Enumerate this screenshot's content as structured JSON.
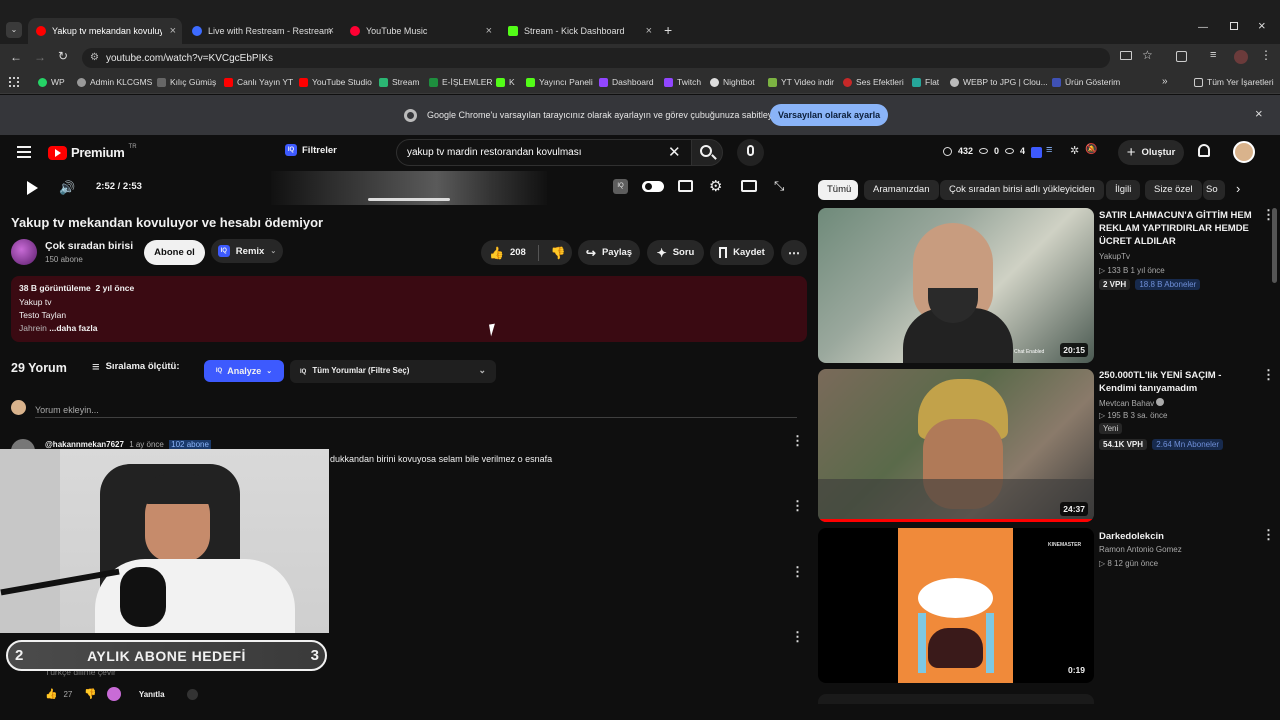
{
  "browser": {
    "tabs": [
      {
        "label": "Yakup tv mekandan kovuluyor ve"
      },
      {
        "label": "Live with Restream - Restream"
      },
      {
        "label": "YouTube Music"
      },
      {
        "label": "Stream - Kick Dashboard"
      }
    ],
    "url": "youtube.com/watch?v=KVCgcEbPIKs",
    "bookmarks": [
      "WP",
      "Admin KLCGMS",
      "Kılıç Gümüş",
      "Canlı Yayın YT",
      "YouTube Studio",
      "Stream",
      "E-İŞLEMLER",
      "K",
      "Yayıncı Paneli",
      "Dashboard",
      "Twitch",
      "Nightbot",
      "YT Video indir",
      "Ses Efektleri",
      "Flat",
      "WEBP to JPG | Clou...",
      "Ürün Gösterim"
    ],
    "all_bookmarks": "Tüm Yer İşaretleri",
    "infobar_text": "Google Chrome'u varsayılan tarayıcınız olarak ayarlayın ve görev çubuğunuza sabitleyin",
    "infobar_button": "Varsayılan olarak ayarla"
  },
  "yt": {
    "logo": "Premium",
    "logo_sup": "TR",
    "filters_label": "Filtreler",
    "search_value": "yakup tv mardin restorandan kovulması",
    "stats": {
      "a": "432",
      "b": "0",
      "c": "4"
    },
    "create_label": "Oluştur"
  },
  "player": {
    "time": "2:52 / 2:53"
  },
  "video": {
    "title": "Yakup tv mekandan kovuluyor ve hesabı ödemiyor",
    "channel": "Çok sıradan birisi",
    "subs": "150 abone",
    "subscribe": "Abone ol",
    "remix": "Remix",
    "likes": "208",
    "share": "Paylaş",
    "ask": "Soru",
    "save": "Kaydet",
    "desc_meta": "38 B görüntüleme  2 yıl önce",
    "desc_lines": [
      "Yakup tv",
      "Testo Taylan",
      "Jahrein"
    ],
    "desc_more": "...daha fazla"
  },
  "comments": {
    "count": "29 Yorum",
    "sort": "Sıralama ölçütü:",
    "analyze": "Analyze",
    "filter": "Tüm Yorumlar (Filtre Seç)",
    "add_placeholder": "Yorum ekleyin...",
    "first_author": "@hakannmekan7627",
    "first_time": "1 ay önce",
    "first_badge": "102 abone",
    "first_text": "dukkandan birini kovuyosa selam bile verilmez o esnafa",
    "last_text": "Türkçe dilime çevir",
    "last_likes": "27",
    "reply": "Yanıtla"
  },
  "overlay": {
    "left": "2",
    "label": "AYLIK ABONE HEDEFİ",
    "right": "3"
  },
  "chips": [
    "Tümü",
    "Aramanızdan",
    "Çok sıradan birisi adlı yükleyiciden",
    "İlgili",
    "Size özel",
    "So"
  ],
  "related": [
    {
      "title": "SATIR LAHMACUN'A GİTTİM HEM REKLAM YAPTIRDIRLAR HEMDE ÜCRET ALDILAR",
      "channel": "YakupTv",
      "meta": "133 B  1 yıl önce",
      "vph": "2 VPH",
      "subs": "18.8 B Aboneler",
      "duration": "20:15",
      "thumb_text": "Chat Enabled"
    },
    {
      "title": "250.000TL'lik YENİ SAÇIM - Kendimi tanıyamadım",
      "channel": "Mevtcan Bahav",
      "meta": "195 B  3 sa. önce",
      "badge": "Yeni",
      "vph": "54.1K VPH",
      "subs": "2.64 Mn Aboneler",
      "duration": "24:37"
    },
    {
      "title": "Darkedolekcin",
      "channel": "Ramon Antonio Gomez",
      "meta": "8  12 gün önce",
      "duration": "0:19",
      "thumb_text": "KINEMASTER"
    }
  ],
  "colors": {
    "yt_red": "#ff0000",
    "iq_blue": "#3d5afe",
    "desc_bg": "#3a0a12",
    "button_blue": "#8ab4f8"
  }
}
